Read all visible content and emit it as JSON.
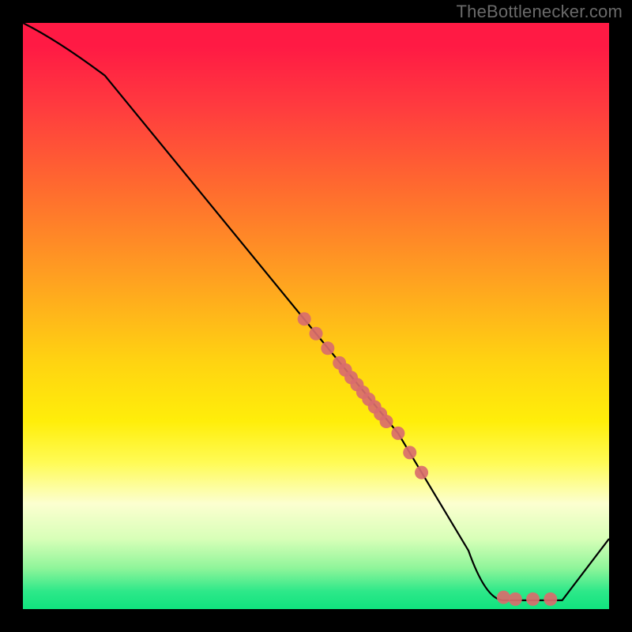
{
  "watermark": "TheBottlenecker.com",
  "chart_data": {
    "type": "line",
    "title": "",
    "xlabel": "",
    "ylabel": "",
    "xlim": [
      0,
      100
    ],
    "ylim": [
      0,
      100
    ],
    "curve": [
      {
        "x": 0,
        "y": 100
      },
      {
        "x": 6,
        "y": 97
      },
      {
        "x": 14,
        "y": 91
      },
      {
        "x": 50,
        "y": 47
      },
      {
        "x": 64,
        "y": 30
      },
      {
        "x": 76,
        "y": 10
      },
      {
        "x": 82,
        "y": 1.5
      },
      {
        "x": 92,
        "y": 1.5
      },
      {
        "x": 100,
        "y": 12
      }
    ],
    "markers": [
      {
        "x": 48,
        "y": 49.5
      },
      {
        "x": 50,
        "y": 47
      },
      {
        "x": 52,
        "y": 44.5
      },
      {
        "x": 54,
        "y": 42
      },
      {
        "x": 55,
        "y": 40.8
      },
      {
        "x": 56,
        "y": 39.5
      },
      {
        "x": 57,
        "y": 38.3
      },
      {
        "x": 58,
        "y": 37
      },
      {
        "x": 59,
        "y": 35.8
      },
      {
        "x": 60,
        "y": 34.5
      },
      {
        "x": 61,
        "y": 33.3
      },
      {
        "x": 62,
        "y": 32
      },
      {
        "x": 64,
        "y": 30
      },
      {
        "x": 66,
        "y": 26.7
      },
      {
        "x": 68,
        "y": 23.3
      },
      {
        "x": 82,
        "y": 2.0
      },
      {
        "x": 84,
        "y": 1.7
      },
      {
        "x": 87,
        "y": 1.7
      },
      {
        "x": 90,
        "y": 1.7
      }
    ],
    "marker_color": "#d96d6c",
    "line_color": "#000000"
  }
}
